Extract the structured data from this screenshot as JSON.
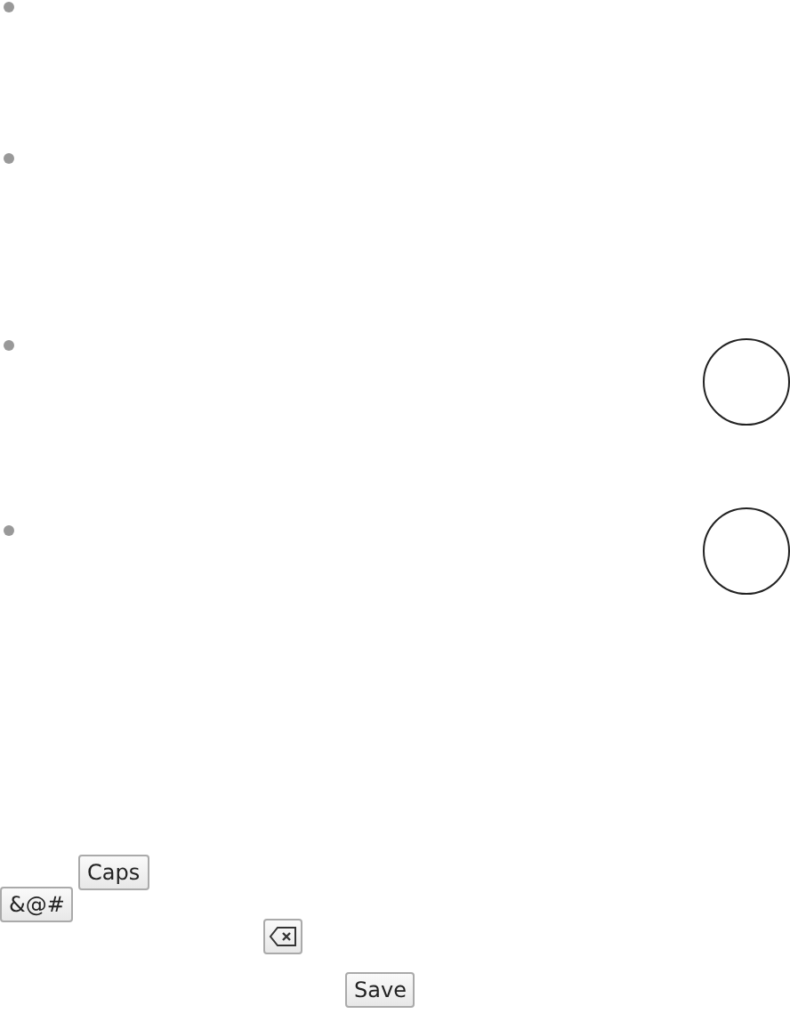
{
  "items": [
    {
      "kind": "plain"
    },
    {
      "kind": "plain"
    },
    {
      "kind": "circle"
    },
    {
      "kind": "circle"
    }
  ],
  "keys": [
    {
      "kind": "text",
      "label": "Caps"
    },
    {
      "kind": "text",
      "label": "&@#"
    },
    {
      "kind": "backspace"
    },
    {
      "kind": "text",
      "label": "Save"
    }
  ]
}
